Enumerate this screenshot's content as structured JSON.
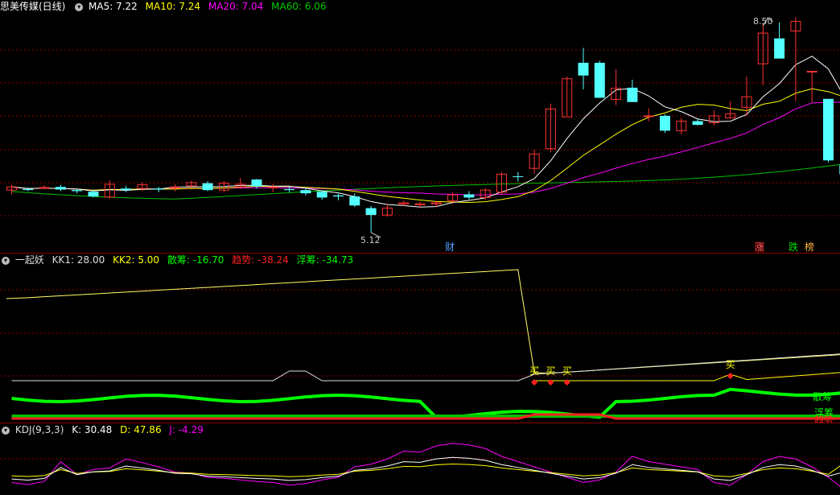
{
  "main": {
    "title": "思美传媒(日线)",
    "ma": [
      {
        "label": "MA5: 7.22",
        "color": "#ffffff"
      },
      {
        "label": "MA10: 7.24",
        "color": "#ffff00"
      },
      {
        "label": "MA20: 7.04",
        "color": "#ff00ff"
      },
      {
        "label": "MA60: 6.06",
        "color": "#00c000"
      }
    ],
    "high_label": "8.50",
    "low_label": "5.12",
    "markers": {
      "cai": "财",
      "zhang": "涨",
      "die": "跌",
      "bang": "榜"
    },
    "price_range": [
      4.8,
      9.2
    ],
    "candles": [
      [
        5.92,
        5.98,
        5.84,
        6.02
      ],
      [
        5.94,
        5.92,
        5.9,
        5.97
      ],
      [
        5.97,
        5.97,
        5.94,
        6.01
      ],
      [
        5.98,
        5.93,
        5.9,
        6.02
      ],
      [
        5.92,
        5.9,
        5.86,
        5.95
      ],
      [
        5.89,
        5.8,
        5.78,
        5.93
      ],
      [
        5.79,
        6.03,
        5.76,
        6.1
      ],
      [
        5.95,
        5.92,
        5.88,
        6.0
      ],
      [
        5.95,
        6.02,
        5.9,
        6.07
      ],
      [
        5.95,
        5.93,
        5.88,
        5.98
      ],
      [
        5.96,
        5.98,
        5.9,
        6.03
      ],
      [
        6.0,
        6.06,
        5.96,
        6.1
      ],
      [
        6.05,
        5.92,
        5.9,
        6.09
      ],
      [
        5.92,
        6.05,
        5.88,
        6.09
      ],
      [
        5.98,
        6.03,
        5.94,
        6.15
      ],
      [
        6.12,
        5.99,
        5.95,
        6.13
      ],
      [
        5.97,
        5.98,
        5.88,
        6.04
      ],
      [
        5.94,
        5.92,
        5.88,
        5.99
      ],
      [
        5.92,
        5.86,
        5.82,
        5.96
      ],
      [
        5.89,
        5.78,
        5.74,
        5.92
      ],
      [
        5.82,
        5.8,
        5.73,
        5.85
      ],
      [
        5.8,
        5.63,
        5.6,
        5.86
      ],
      [
        5.58,
        5.45,
        5.12,
        5.62
      ],
      [
        5.45,
        5.58,
        5.42,
        5.66
      ],
      [
        5.66,
        5.68,
        5.62,
        5.72
      ],
      [
        5.66,
        5.66,
        5.58,
        5.7
      ],
      [
        5.66,
        5.68,
        5.6,
        5.72
      ],
      [
        5.72,
        5.83,
        5.66,
        5.88
      ],
      [
        5.84,
        5.78,
        5.74,
        5.9
      ],
      [
        5.78,
        5.92,
        5.74,
        5.96
      ],
      [
        5.88,
        6.22,
        5.83,
        6.26
      ],
      [
        6.18,
        6.17,
        6.08,
        6.26
      ],
      [
        6.33,
        6.6,
        6.23,
        6.68
      ],
      [
        6.7,
        7.45,
        6.63,
        7.55
      ],
      [
        7.3,
        8.02,
        7.32,
        8.06
      ],
      [
        8.32,
        8.08,
        7.82,
        8.6
      ],
      [
        8.32,
        7.66,
        7.66,
        8.36
      ],
      [
        7.63,
        7.84,
        7.52,
        8.2
      ],
      [
        7.85,
        7.58,
        7.58,
        8.0
      ],
      [
        7.32,
        7.32,
        7.22,
        7.46
      ],
      [
        7.32,
        7.04,
        7.0,
        7.35
      ],
      [
        7.04,
        7.22,
        6.97,
        7.28
      ],
      [
        7.22,
        7.15,
        7.14,
        7.26
      ],
      [
        7.19,
        7.32,
        7.14,
        7.42
      ],
      [
        7.28,
        7.36,
        7.28,
        7.6
      ],
      [
        7.48,
        7.68,
        7.32,
        8.06
      ],
      [
        8.3,
        8.88,
        7.9,
        9.06
      ],
      [
        8.78,
        8.4,
        8.56,
        9.08
      ],
      [
        8.92,
        9.1,
        7.6,
        9.18
      ],
      [
        8.16,
        8.16,
        7.58,
        8.16
      ],
      [
        7.64,
        6.48,
        6.44,
        7.42
      ],
      [
        6.4,
        6.22,
        6.1,
        6.62
      ]
    ]
  },
  "indicator": {
    "name": "一起妖",
    "values": [
      {
        "label": "KK1: 28.00",
        "color": "#dddddd"
      },
      {
        "label": "KK2: 5.00",
        "color": "#ffff00"
      },
      {
        "label": "散筹: -16.70",
        "color": "#00ff00"
      },
      {
        "label": "趋势: -38.24",
        "color": "#ff2020"
      },
      {
        "label": "浮筹: -34.73",
        "color": "#00ff00"
      }
    ],
    "buy_label": "买",
    "right_labels": {
      "san": "散筹",
      "fu": "浮筹",
      "qu": "趋势"
    },
    "buy_idx": [
      32,
      33,
      34,
      44
    ]
  },
  "kdj": {
    "name": "KDJ(9,3,3)",
    "values": [
      {
        "label": "K: 30.48",
        "color": "#ffffff"
      },
      {
        "label": "D: 47.86",
        "color": "#ffff00"
      },
      {
        "label": "J: -4.29",
        "color": "#ff00ff"
      }
    ]
  },
  "colors": {
    "up": "#ff3232",
    "down": "#54ffff",
    "grid": "#8b0000"
  }
}
